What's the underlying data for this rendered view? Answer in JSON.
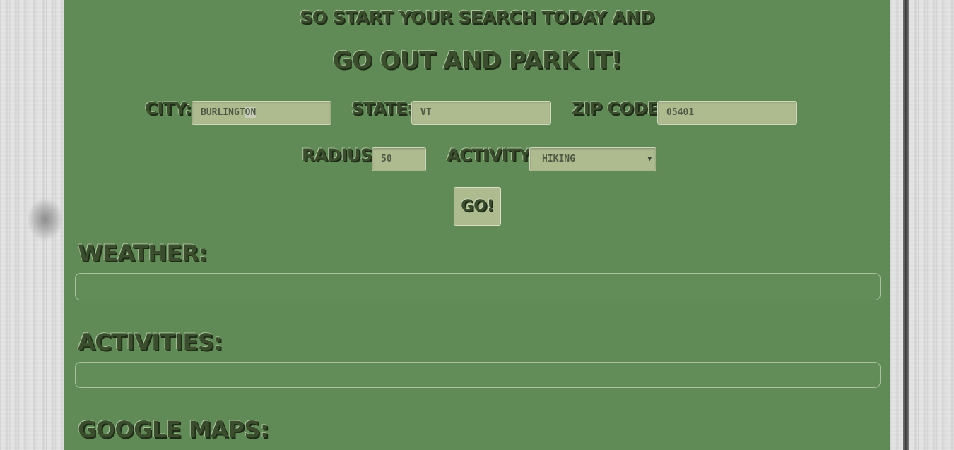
{
  "header": {
    "tagline": "So start your search today and",
    "title": "Go out and park it!"
  },
  "form": {
    "city": {
      "label": "City:",
      "value_main": "BURLINGT",
      "value_highlight": "ON"
    },
    "state": {
      "label": "State:",
      "value": "VT"
    },
    "zip": {
      "label": "Zip Code:",
      "value": "05401"
    },
    "radius": {
      "label": "Radius:",
      "value": "50"
    },
    "activity": {
      "label": "Activity:",
      "selected": "HIKING"
    },
    "go_label": "Go!"
  },
  "sections": {
    "weather": "Weather:",
    "activities": "Activities:",
    "maps": "Google Maps:"
  },
  "colors": {
    "panel": "#608a56",
    "field": "#adbb8f",
    "text_dark": "#3a4d2c"
  },
  "icons": {
    "dropdown": "chevron-down-icon"
  }
}
